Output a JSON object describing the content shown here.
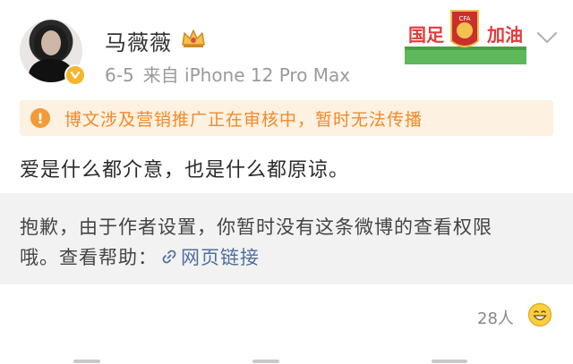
{
  "post": {
    "username": "马薇薇",
    "date": "6-5",
    "source": "来自 iPhone 12 Pro Max",
    "notice": "博文涉及营销推广正在审核中，暂时无法传播",
    "content": "爱是什么都介意，也是什么都原谅。",
    "repost_line1": "抱歉，由于作者设置，你暂时没有这条微博的查看权限",
    "repost_line2_prefix": "哦。查看帮助：",
    "repost_link": "网页链接",
    "likes": "28人"
  },
  "badge": {
    "text_left": "国足",
    "text_right": "加油",
    "emblem": "CFA"
  },
  "icons": {
    "verify": "verified-badge-icon",
    "vip": "crown-icon",
    "warning": "warning-icon",
    "link": "link-icon",
    "emoji": "smile-emoji-icon",
    "more": "chevron-down-icon"
  },
  "colors": {
    "notice_bg": "#fdf1e1",
    "notice_text": "#f08a2a",
    "link": "#4f6ea0",
    "repost_bg": "#f2f2f2",
    "verify": "#f7b52c"
  }
}
